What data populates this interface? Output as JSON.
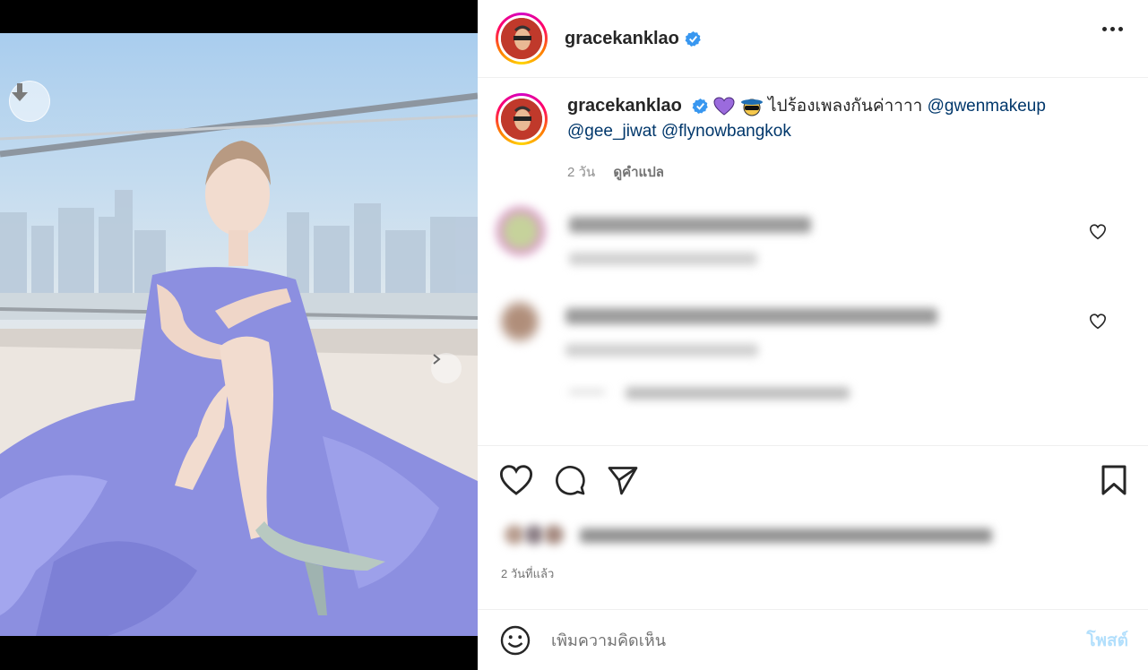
{
  "post": {
    "username": "gracekanklao",
    "verified": true,
    "media": {
      "carousel_count": 3,
      "current_index": 1,
      "download_icon": "download-arrow-icon",
      "next_icon": "chevron-right-icon"
    }
  },
  "caption": {
    "username": "gracekanklao",
    "emoji_1": "purple-heart-emoji",
    "emoji_2": "disguise-face-emoji",
    "text": "ไปร้องเพลงกันค่าาาา",
    "mentions": [
      "@gwenmakeup",
      "@gee_jiwat",
      "@flynowbangkok"
    ],
    "time": "2 วัน",
    "translate_label": "ดูคำแปล"
  },
  "comments_blurred": true,
  "actions": {
    "like_icon": "heart-icon",
    "comment_icon": "comment-bubble-icon",
    "share_icon": "paper-plane-icon",
    "save_icon": "bookmark-icon"
  },
  "time_ago": "2 วันที่แล้ว",
  "comment_box": {
    "placeholder": "เพิ่มความคิดเห็น",
    "post_label": "โพสต์",
    "emoji_icon": "smiley-icon"
  },
  "colors": {
    "verified_blue": "#3897f0",
    "mention": "#00376b",
    "post_disabled": "#b2dffc",
    "text": "#262626",
    "muted": "#737373"
  }
}
